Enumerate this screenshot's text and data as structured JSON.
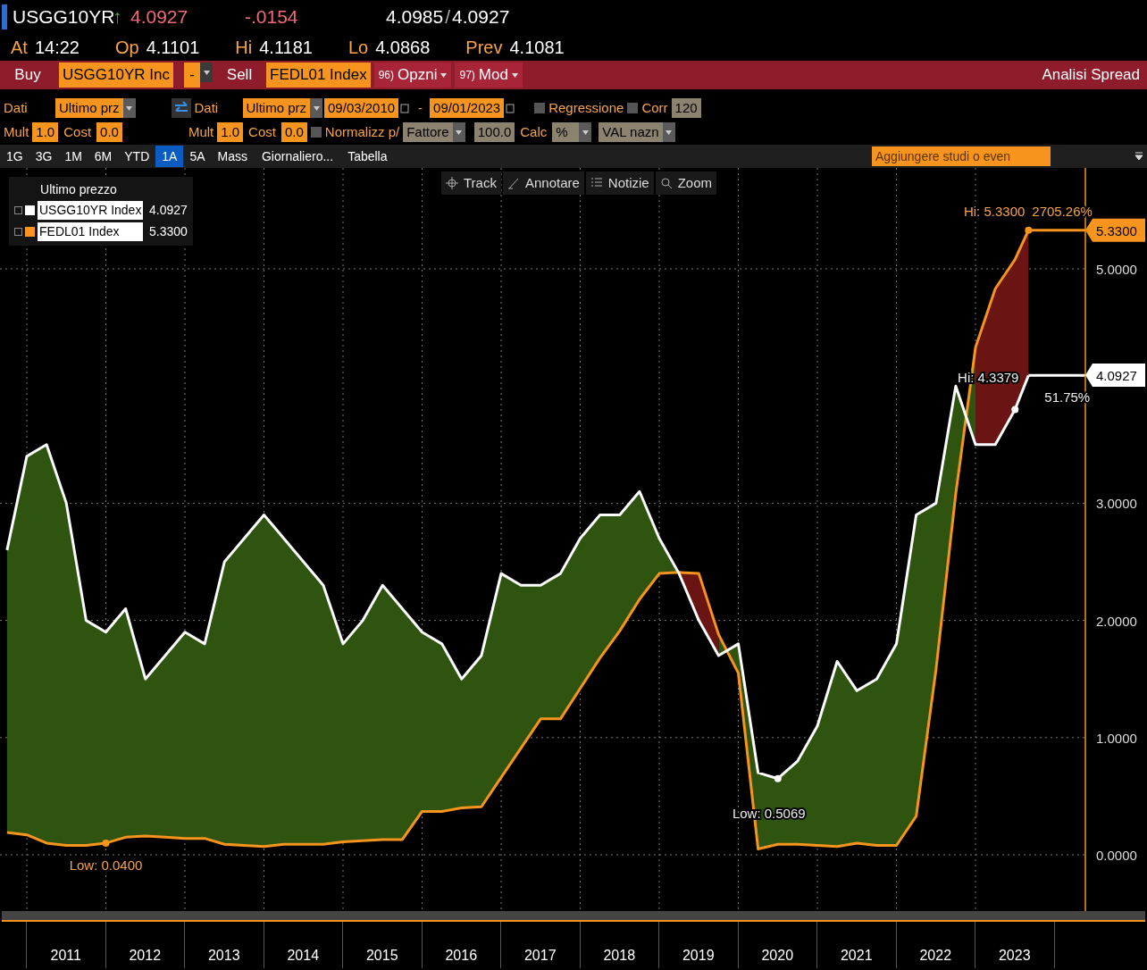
{
  "quote": {
    "ticker": "USGG10YR",
    "arrow": "↑",
    "last": "4.0927",
    "change": "-.0154",
    "bid": "4.0985",
    "separator": "/",
    "ask": "4.0927"
  },
  "stats": [
    {
      "label": "At",
      "value": "14:22"
    },
    {
      "label": "Op",
      "value": "4.1101"
    },
    {
      "label": "Hi",
      "value": "4.1181"
    },
    {
      "label": "Lo",
      "value": "4.0868"
    },
    {
      "label": "Prev",
      "value": "4.1081"
    }
  ],
  "command_bar": {
    "buy_label": "Buy",
    "buy_value": "USGG10YR Inc",
    "operator": "-",
    "sell_label": "Sell",
    "sell_value": "FEDL01 Index",
    "menus": [
      {
        "number": "96)",
        "label": "Opzni"
      },
      {
        "number": "97)",
        "label": "Mod"
      }
    ],
    "title": "Analisi Spread"
  },
  "settings_row1": {
    "left": {
      "label": "Dati",
      "value": "Ultimo prz"
    },
    "right": {
      "label": "Dati",
      "value": "Ultimo prz"
    },
    "start_date": "09/03/2010",
    "separator": "-",
    "end_date": "09/01/2023",
    "regression": {
      "label": "Regressione",
      "checked": false
    },
    "corr": {
      "label": "Corr",
      "checked": false,
      "value": "120"
    }
  },
  "settings_row2": {
    "left_mult": {
      "label": "Mult",
      "value": "1.0"
    },
    "left_cost": {
      "label": "Cost",
      "value": "0.0"
    },
    "right_mult": {
      "label": "Mult",
      "value": "1.0"
    },
    "right_cost": {
      "label": "Cost",
      "value": "0.0"
    },
    "normalize": {
      "label": "Normalizz p/",
      "checked": false
    },
    "method": {
      "value": "Fattore",
      "disabled": true
    },
    "factor": {
      "value": "100.0",
      "disabled": true
    },
    "calc": {
      "label": "Calc",
      "value": "%",
      "disabled": true
    },
    "currency": {
      "value": "VAL nazn",
      "disabled": true
    }
  },
  "periods": [
    {
      "label": "1G",
      "selected": false
    },
    {
      "label": "3G",
      "selected": false
    },
    {
      "label": "1M",
      "selected": false
    },
    {
      "label": "6M",
      "selected": false
    },
    {
      "label": "YTD",
      "selected": false
    },
    {
      "label": "1A",
      "selected": true
    },
    {
      "label": "5A",
      "selected": false
    },
    {
      "label": "Mass",
      "selected": false
    }
  ],
  "period_menus": [
    "Giornaliero...",
    "Tabella"
  ],
  "studies_field": {
    "placeholder": "Aggiungere studi o even"
  },
  "chart_toolbar": [
    {
      "kind": "track",
      "label": "Track"
    },
    {
      "kind": "annotate",
      "label": "Annotare"
    },
    {
      "kind": "news",
      "label": "Notizie"
    },
    {
      "kind": "zoom",
      "label": "Zoom"
    }
  ],
  "legend": {
    "title": "Ultimo prezzo",
    "items": [
      {
        "value": "4.0927"
      },
      {
        "value": "5.3300"
      }
    ]
  },
  "last_value_tags": [
    {
      "text": "5.3300"
    },
    {
      "text": "4.0927"
    }
  ],
  "chart_data": {
    "type": "line",
    "x": [
      2010.75,
      2011,
      2011.25,
      2011.5,
      2011.75,
      2012,
      2012.25,
      2012.5,
      2012.75,
      2013,
      2013.25,
      2013.5,
      2013.75,
      2014,
      2014.25,
      2014.5,
      2014.75,
      2015,
      2015.25,
      2015.5,
      2015.75,
      2016,
      2016.25,
      2016.5,
      2016.75,
      2017,
      2017.25,
      2017.5,
      2017.75,
      2018,
      2018.25,
      2018.5,
      2018.75,
      2019,
      2019.25,
      2019.5,
      2019.75,
      2020,
      2020.25,
      2020.5,
      2020.75,
      2021,
      2021.25,
      2021.5,
      2021.75,
      2022,
      2022.25,
      2022.5,
      2022.75,
      2023,
      2023.25,
      2023.5,
      2023.67
    ],
    "series": [
      {
        "name": "USGG10YR Index",
        "color": "#ffffff",
        "values": [
          2.6,
          3.4,
          3.5,
          3.0,
          2.0,
          1.9,
          2.1,
          1.5,
          1.7,
          1.9,
          1.8,
          2.5,
          2.7,
          2.9,
          2.7,
          2.5,
          2.3,
          1.8,
          2.0,
          2.3,
          2.1,
          1.9,
          1.8,
          1.5,
          1.7,
          2.4,
          2.3,
          2.3,
          2.4,
          2.7,
          2.9,
          2.9,
          3.1,
          2.7,
          2.4,
          2.0,
          1.7,
          1.8,
          0.7,
          0.65,
          0.8,
          1.1,
          1.65,
          1.4,
          1.5,
          1.8,
          2.9,
          3.0,
          4.0,
          3.5,
          3.5,
          3.8,
          4.09
        ]
      },
      {
        "name": "FEDL01 Index",
        "color": "#f7941d",
        "values": [
          0.19,
          0.17,
          0.1,
          0.08,
          0.08,
          0.1,
          0.15,
          0.16,
          0.15,
          0.14,
          0.14,
          0.09,
          0.08,
          0.07,
          0.09,
          0.09,
          0.09,
          0.11,
          0.12,
          0.13,
          0.13,
          0.37,
          0.37,
          0.4,
          0.41,
          0.66,
          0.91,
          1.16,
          1.16,
          1.42,
          1.68,
          1.91,
          2.18,
          2.4,
          2.41,
          2.4,
          1.88,
          1.55,
          0.05,
          0.09,
          0.09,
          0.08,
          0.07,
          0.1,
          0.08,
          0.08,
          0.33,
          1.58,
          3.08,
          4.33,
          4.83,
          5.08,
          5.33
        ]
      }
    ],
    "legend": "upper left",
    "xlim": [
      2010.661,
      2025.169
    ],
    "ylim": [
      -0.48,
      5.861
    ],
    "grid": true,
    "xticks": [
      {
        "value": 2011.5,
        "label": "2011"
      },
      {
        "value": 2012.5,
        "label": "2012"
      },
      {
        "value": 2013.5,
        "label": "2013"
      },
      {
        "value": 2014.5,
        "label": "2014"
      },
      {
        "value": 2015.5,
        "label": "2015"
      },
      {
        "value": 2016.5,
        "label": "2016"
      },
      {
        "value": 2017.5,
        "label": "2017"
      },
      {
        "value": 2018.5,
        "label": "2018"
      },
      {
        "value": 2019.5,
        "label": "2019"
      },
      {
        "value": 2020.5,
        "label": "2020"
      },
      {
        "value": 2021.5,
        "label": "2021"
      },
      {
        "value": 2022.5,
        "label": "2022"
      },
      {
        "value": 2023.5,
        "label": "2023"
      }
    ],
    "yticks": [
      {
        "value": 0,
        "label": "0.0000"
      },
      {
        "value": 1,
        "label": "1.0000"
      },
      {
        "value": 2,
        "label": "2.0000"
      },
      {
        "value": 3,
        "label": "3.0000"
      },
      {
        "value": 5,
        "label": "5.0000"
      }
    ],
    "annotations": [
      {
        "text": "Hi: 5.3300",
        "x": 2023.67,
        "y": 5.33
      },
      "2705.26%",
      {
        "text": "Hi: 4.3379",
        "x": 2023.5,
        "y": 3.8
      },
      "51.75%",
      {
        "text": "Low: 0.5069",
        "x": 2020.5,
        "y": 0.65
      },
      {
        "text": "Low: 0.0400",
        "x": 2012,
        "y": 0.1
      }
    ]
  }
}
